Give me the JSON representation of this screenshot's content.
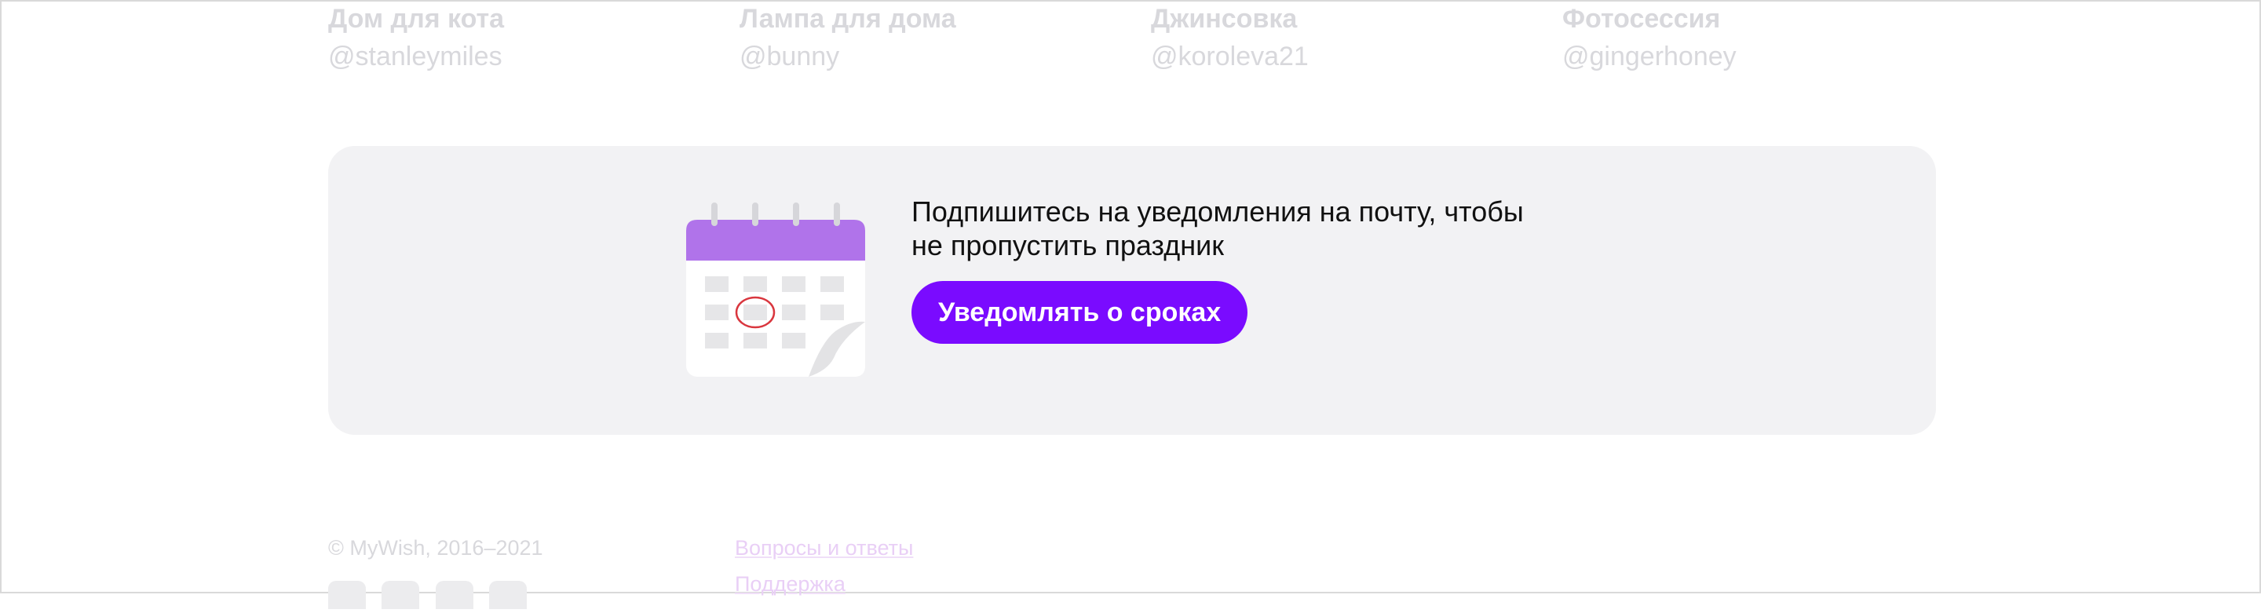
{
  "wishes": [
    {
      "title": "Дом для кота",
      "author": "@stanleymiles"
    },
    {
      "title": "Лампа для дома",
      "author": "@bunny"
    },
    {
      "title": "Джинсовка",
      "author": "@koroleva21"
    },
    {
      "title": "Фотосессия",
      "author": "@gingerhoney"
    }
  ],
  "subscribe": {
    "text_line1": "Подпишитесь на уведомления на почту, чтобы",
    "text_line2": "не пропустить праздник",
    "button_label": "Уведомлять о сроках"
  },
  "footer": {
    "copyright": "© MyWish, 2016–2021",
    "links": [
      "Вопросы и ответы",
      "Поддержка"
    ],
    "socials": [
      "vk-icon",
      "youtube-icon",
      "facebook-icon",
      "instagram-icon"
    ]
  },
  "colors": {
    "accent": "#7a0bff",
    "calendar_header": "#b073ea",
    "banner_bg": "#f2f2f4",
    "faded_text": "#d8d8dc",
    "marker_circle": "#d9363e"
  }
}
